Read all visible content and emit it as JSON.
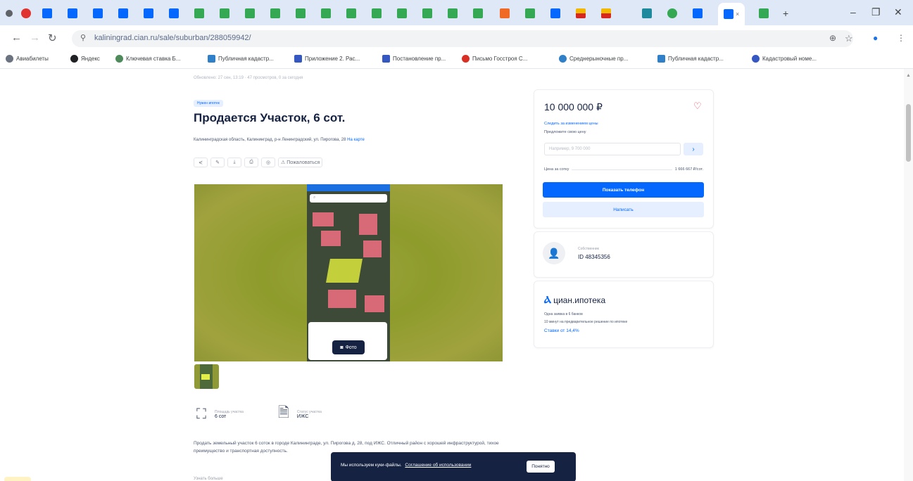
{
  "browser": {
    "active_tab_close": "×",
    "new_tab": "+",
    "url": "kaliningrad.cian.ru/sale/suburban/288059942/",
    "window": {
      "minimize": "–",
      "restore": "❐",
      "close": "✕"
    },
    "bookmarks": [
      {
        "label": "Авиабилеты",
        "color": "#6b7280"
      },
      {
        "label": "Яндекс",
        "color": "#202124"
      },
      {
        "label": "Ключевая ставка Б...",
        "color": "#4f8a5b"
      },
      {
        "label": "Публичная кадастр...",
        "color": "#2f80c9"
      },
      {
        "label": "Приложение 2. Рас...",
        "color": "#3557c2"
      },
      {
        "label": "Постановление пр...",
        "color": "#3557c2"
      },
      {
        "label": "Письмо Госстроя С...",
        "color": "#d93025"
      },
      {
        "label": "Среднерыночные пр...",
        "color": "#2f80c9"
      },
      {
        "label": "Публичная кадастр...",
        "color": "#2f80c9"
      },
      {
        "label": "Кадастровый номе...",
        "color": "#3557c2"
      }
    ]
  },
  "listing": {
    "meta": "Обновлено: 27 сен, 13:19 · 47 просмотров, 0 за сегодня",
    "badge": "Нужен ипотек",
    "title": "Продается Участок, 6 сот.",
    "address": "Калининградская область, Калининград, р-н Ленинградский, ул. Пирогова, 28",
    "map_link": "На карте",
    "report_label": "Пожаловаться",
    "photo_button": "Фото",
    "facts": [
      {
        "label": "Площадь участка",
        "value": "6 сот"
      },
      {
        "label": "Статус участка",
        "value": "ИЖС"
      }
    ],
    "description": "Продать земельный участок 6 соток в городе Калининграде, ул. Пирогова д. 28, под ИЖС. Отличный район с хорошей инфраструктурой, тихое преимущество и транспортная доступность.",
    "description_more": "Узнать больше"
  },
  "price_card": {
    "price": "10 000 000 ₽",
    "history_link": "Следить за изменением цены",
    "offer_label": "Предложите свою цену",
    "offer_placeholder": "Например, 9 700 000",
    "price_per_unit_label": "Цена за сотку",
    "price_per_unit_value": "1 666 667 ₽/сот.",
    "show_phone": "Показать телефон",
    "write": "Написать"
  },
  "owner_card": {
    "label": "Собственник",
    "id": "ID 48345356"
  },
  "mortgage_card": {
    "brand_mark": "Ⲁ",
    "brand_text": "циан.ипотека",
    "line1": "Одна заявка в 6 банков",
    "line2": "10 минут на предварительное решение по ипотеке",
    "rate": "Ставки от 14,4%"
  },
  "cookie": {
    "text": "Мы используем куки-файлы.",
    "link": "Соглашение об использовании",
    "ok": "Понятно"
  }
}
